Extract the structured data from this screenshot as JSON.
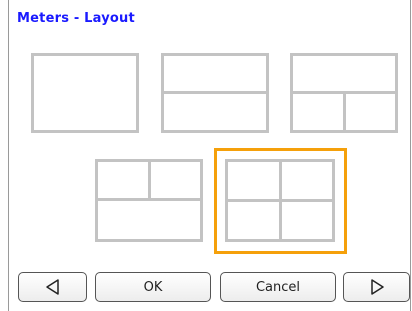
{
  "window": {
    "title": "Meters - Layout"
  },
  "layouts": [
    {
      "name": "single"
    },
    {
      "name": "two-rows"
    },
    {
      "name": "two-over-top-split-bottom"
    },
    {
      "name": "split-top-over-one"
    },
    {
      "name": "quad",
      "selected": true
    }
  ],
  "buttons": {
    "prev_icon": "triangle-left-icon",
    "ok_label": "OK",
    "cancel_label": "Cancel",
    "next_icon": "triangle-right-icon"
  },
  "colors": {
    "title": "#1a1aff",
    "layout_border": "#c3c3c3",
    "selection": "#f5a00a"
  }
}
